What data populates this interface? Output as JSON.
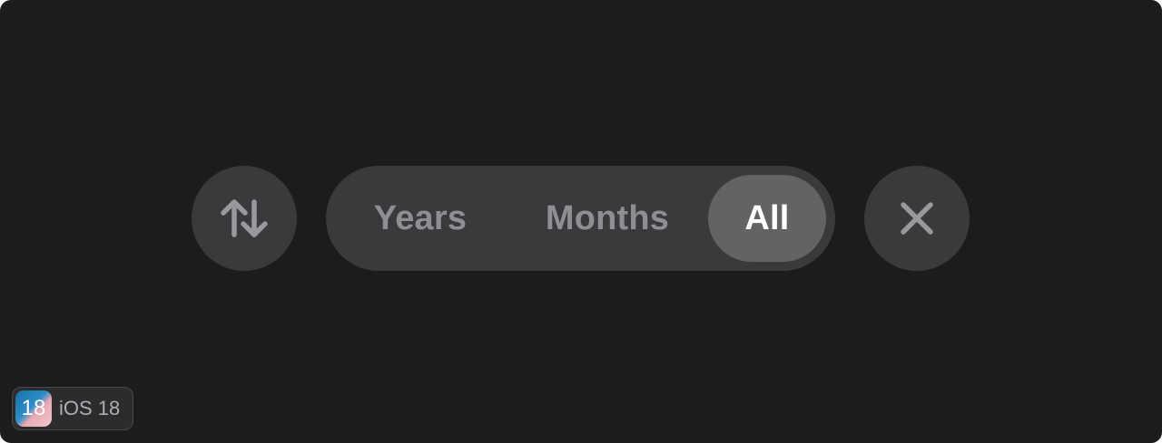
{
  "filter_bar": {
    "sort_icon": "sort-arrows-icon",
    "segments": [
      {
        "label": "Years",
        "selected": false
      },
      {
        "label": "Months",
        "selected": false
      },
      {
        "label": "All",
        "selected": true
      }
    ],
    "close_icon": "close-icon"
  },
  "badge": {
    "logo_text": "18",
    "label": "iOS 18"
  },
  "colors": {
    "background": "#1c1c1e",
    "control_fill": "#3a3a3c",
    "selected_fill": "#636366",
    "inactive_text": "#8e8e93",
    "active_text": "#ffffff"
  }
}
